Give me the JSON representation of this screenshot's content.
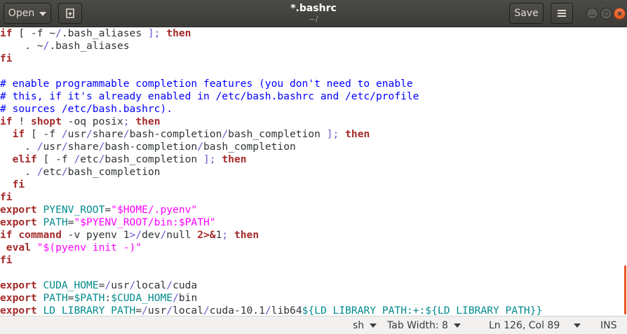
{
  "header": {
    "open_label": "Open",
    "title": "*.bashrc",
    "subtitle": "~/",
    "save_label": "Save"
  },
  "editor": {
    "lines": [
      [
        {
          "t": "if",
          "c": "kw"
        },
        {
          "t": " [ -f ~",
          "c": "pl"
        },
        {
          "t": "/",
          "c": "op"
        },
        {
          "t": ".bash_aliases ",
          "c": "pl"
        },
        {
          "t": "];",
          "c": "op"
        },
        {
          "t": " ",
          "c": "pl"
        },
        {
          "t": "then",
          "c": "kw"
        }
      ],
      [
        {
          "t": "    . ~",
          "c": "pl"
        },
        {
          "t": "/",
          "c": "op"
        },
        {
          "t": ".bash_aliases",
          "c": "pl"
        }
      ],
      [
        {
          "t": "fi",
          "c": "kw"
        }
      ],
      [],
      [
        {
          "t": "# enable programmable completion features (you don't need to enable",
          "c": "cm"
        }
      ],
      [
        {
          "t": "# this, if it's already enabled in /etc/bash.bashrc and /etc/profile",
          "c": "cm"
        }
      ],
      [
        {
          "t": "# sources /etc/bash.bashrc).",
          "c": "cm"
        }
      ],
      [
        {
          "t": "if",
          "c": "kw"
        },
        {
          "t": " ! ",
          "c": "pl"
        },
        {
          "t": "shopt",
          "c": "kw"
        },
        {
          "t": " -oq posix",
          "c": "pl"
        },
        {
          "t": ";",
          "c": "op"
        },
        {
          "t": " ",
          "c": "pl"
        },
        {
          "t": "then",
          "c": "kw"
        }
      ],
      [
        {
          "t": "  ",
          "c": "pl"
        },
        {
          "t": "if",
          "c": "kw"
        },
        {
          "t": " [ -f ",
          "c": "pl"
        },
        {
          "t": "/",
          "c": "op"
        },
        {
          "t": "usr",
          "c": "pl"
        },
        {
          "t": "/",
          "c": "op"
        },
        {
          "t": "share",
          "c": "pl"
        },
        {
          "t": "/",
          "c": "op"
        },
        {
          "t": "bash-completion",
          "c": "pl"
        },
        {
          "t": "/",
          "c": "op"
        },
        {
          "t": "bash_completion ",
          "c": "pl"
        },
        {
          "t": "];",
          "c": "op"
        },
        {
          "t": " ",
          "c": "pl"
        },
        {
          "t": "then",
          "c": "kw"
        }
      ],
      [
        {
          "t": "    . ",
          "c": "pl"
        },
        {
          "t": "/",
          "c": "op"
        },
        {
          "t": "usr",
          "c": "pl"
        },
        {
          "t": "/",
          "c": "op"
        },
        {
          "t": "share",
          "c": "pl"
        },
        {
          "t": "/",
          "c": "op"
        },
        {
          "t": "bash-completion",
          "c": "pl"
        },
        {
          "t": "/",
          "c": "op"
        },
        {
          "t": "bash_completion",
          "c": "pl"
        }
      ],
      [
        {
          "t": "  ",
          "c": "pl"
        },
        {
          "t": "elif",
          "c": "kw"
        },
        {
          "t": " [ -f ",
          "c": "pl"
        },
        {
          "t": "/",
          "c": "op"
        },
        {
          "t": "etc",
          "c": "pl"
        },
        {
          "t": "/",
          "c": "op"
        },
        {
          "t": "bash_completion ",
          "c": "pl"
        },
        {
          "t": "];",
          "c": "op"
        },
        {
          "t": " ",
          "c": "pl"
        },
        {
          "t": "then",
          "c": "kw"
        }
      ],
      [
        {
          "t": "    . ",
          "c": "pl"
        },
        {
          "t": "/",
          "c": "op"
        },
        {
          "t": "etc",
          "c": "pl"
        },
        {
          "t": "/",
          "c": "op"
        },
        {
          "t": "bash_completion",
          "c": "pl"
        }
      ],
      [
        {
          "t": "  ",
          "c": "pl"
        },
        {
          "t": "fi",
          "c": "kw"
        }
      ],
      [
        {
          "t": "fi",
          "c": "kw"
        }
      ],
      [
        {
          "t": "export",
          "c": "kw"
        },
        {
          "t": " ",
          "c": "pl"
        },
        {
          "t": "PYENV_ROOT",
          "c": "vr"
        },
        {
          "t": "=",
          "c": "pl"
        },
        {
          "t": "\"$HOME/.pyenv\"",
          "c": "st"
        }
      ],
      [
        {
          "t": "export",
          "c": "kw"
        },
        {
          "t": " ",
          "c": "pl"
        },
        {
          "t": "PATH",
          "c": "vr"
        },
        {
          "t": "=",
          "c": "pl"
        },
        {
          "t": "\"$PYENV_ROOT/bin:$PATH\"",
          "c": "st"
        }
      ],
      [
        {
          "t": "if",
          "c": "kw"
        },
        {
          "t": " ",
          "c": "pl"
        },
        {
          "t": "command",
          "c": "kw"
        },
        {
          "t": " -v pyenv 1",
          "c": "pl"
        },
        {
          "t": ">/",
          "c": "op"
        },
        {
          "t": "dev",
          "c": "pl"
        },
        {
          "t": "/",
          "c": "op"
        },
        {
          "t": "null ",
          "c": "pl"
        },
        {
          "t": "2>&",
          "c": "kw"
        },
        {
          "t": "1",
          "c": "pl"
        },
        {
          "t": ";",
          "c": "op"
        },
        {
          "t": " ",
          "c": "pl"
        },
        {
          "t": "then",
          "c": "kw"
        }
      ],
      [
        {
          "t": " ",
          "c": "pl"
        },
        {
          "t": "eval",
          "c": "kw"
        },
        {
          "t": " ",
          "c": "pl"
        },
        {
          "t": "\"$(pyenv init -)\"",
          "c": "st"
        }
      ],
      [
        {
          "t": "fi",
          "c": "kw"
        }
      ],
      [],
      [
        {
          "t": "export",
          "c": "kw"
        },
        {
          "t": " ",
          "c": "pl"
        },
        {
          "t": "CUDA_HOME",
          "c": "vr"
        },
        {
          "t": "=",
          "c": "pl"
        },
        {
          "t": "/",
          "c": "op"
        },
        {
          "t": "usr",
          "c": "pl"
        },
        {
          "t": "/",
          "c": "op"
        },
        {
          "t": "local",
          "c": "pl"
        },
        {
          "t": "/",
          "c": "op"
        },
        {
          "t": "cuda",
          "c": "pl"
        }
      ],
      [
        {
          "t": "export",
          "c": "kw"
        },
        {
          "t": " ",
          "c": "pl"
        },
        {
          "t": "PATH",
          "c": "vr"
        },
        {
          "t": "=",
          "c": "pl"
        },
        {
          "t": "$PATH",
          "c": "vr"
        },
        {
          "t": ":",
          "c": "pl"
        },
        {
          "t": "$CUDA_HOME",
          "c": "vr"
        },
        {
          "t": "/",
          "c": "op"
        },
        {
          "t": "bin",
          "c": "pl"
        }
      ],
      [
        {
          "t": "export",
          "c": "kw"
        },
        {
          "t": " ",
          "c": "pl"
        },
        {
          "t": "LD_LIBRARY_PATH",
          "c": "vr"
        },
        {
          "t": "=",
          "c": "pl"
        },
        {
          "t": "/",
          "c": "op"
        },
        {
          "t": "usr",
          "c": "pl"
        },
        {
          "t": "/",
          "c": "op"
        },
        {
          "t": "local",
          "c": "pl"
        },
        {
          "t": "/",
          "c": "op"
        },
        {
          "t": "cuda-10.1",
          "c": "pl"
        },
        {
          "t": "/",
          "c": "op"
        },
        {
          "t": "lib64",
          "c": "pl"
        },
        {
          "t": "${LD_LIBRARY_PATH:+:${LD_LIBRARY_PATH}}",
          "c": "vr"
        }
      ]
    ]
  },
  "statusbar": {
    "language": "sh",
    "tab_width": "Tab Width: 8",
    "position": "Ln 126, Col 89",
    "mode": "INS"
  },
  "colors": {
    "keyword": "#a52a2a",
    "comment": "#0000ff",
    "string": "#ff00ff",
    "variable": "#008a8c",
    "accent": "#e95420"
  },
  "icons": [
    "pin-document-icon",
    "hamburger-menu-icon",
    "minimize-icon",
    "maximize-icon",
    "close-icon",
    "chevron-down-icon"
  ]
}
